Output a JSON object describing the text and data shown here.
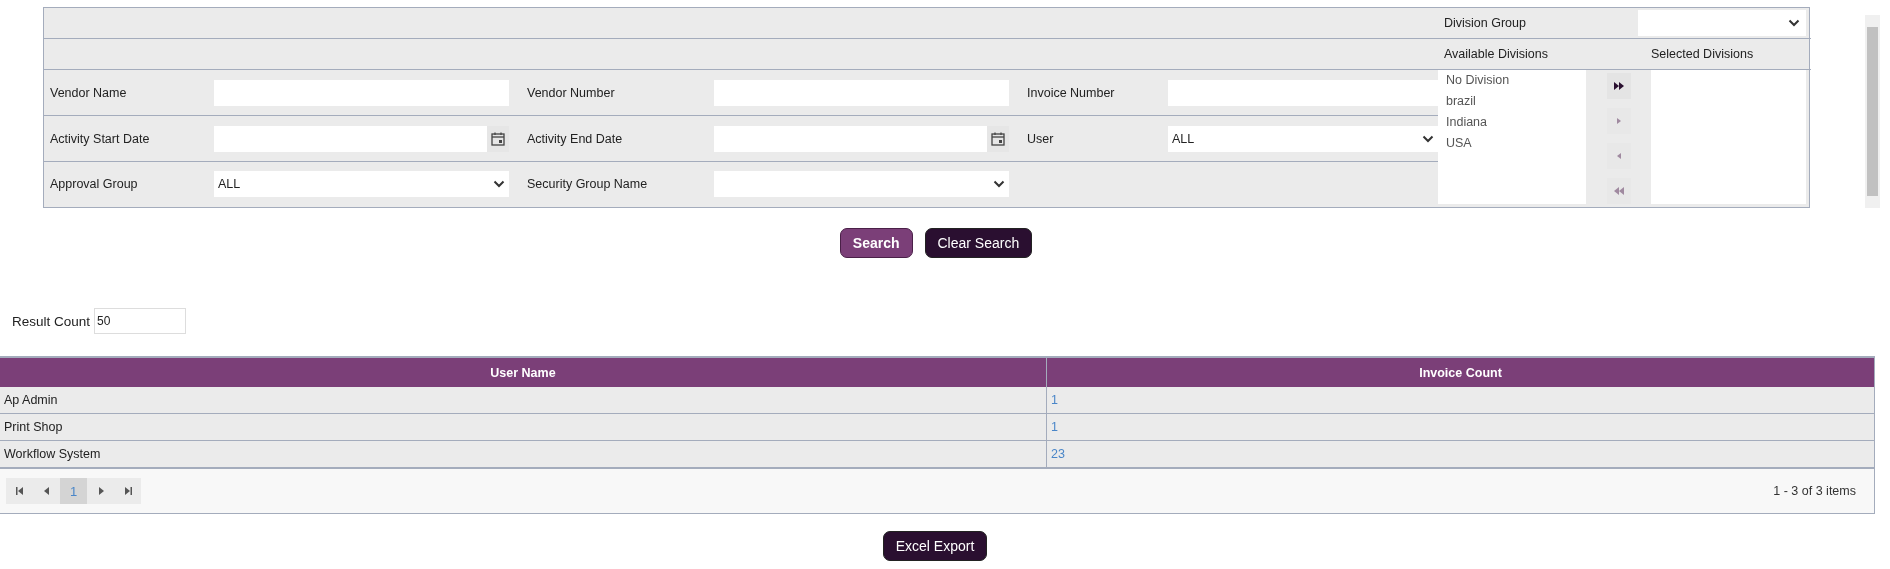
{
  "division_group": {
    "label": "Division Group"
  },
  "filter_rows": [
    {
      "fields": [
        {
          "label": "Vendor Name",
          "kind": "text"
        },
        {
          "label": "Vendor Number",
          "kind": "text"
        },
        {
          "label": "Invoice Number",
          "kind": "text"
        }
      ]
    },
    {
      "fields": [
        {
          "label": "Activity Start Date",
          "kind": "date"
        },
        {
          "label": "Activity End Date",
          "kind": "date"
        },
        {
          "label": "User",
          "kind": "select",
          "value": "ALL"
        }
      ]
    },
    {
      "fields": [
        {
          "label": "Approval Group",
          "kind": "select",
          "value": "ALL"
        },
        {
          "label": "Security Group Name",
          "kind": "select"
        }
      ]
    }
  ],
  "divisions": {
    "available_label": "Available Divisions",
    "selected_label": "Selected Divisions",
    "available": [
      "No Division",
      "brazil",
      "Indiana",
      "USA"
    ],
    "transfer_buttons": [
      {
        "kind": "move-all-right",
        "disabled": false
      },
      {
        "kind": "move-right",
        "disabled": true
      },
      {
        "kind": "move-left",
        "disabled": true
      },
      {
        "kind": "move-all-left",
        "disabled": true
      }
    ]
  },
  "buttons": [
    {
      "label": "Search",
      "kind": "primary"
    },
    {
      "label": "Clear Search",
      "kind": "secondary"
    }
  ],
  "result_count": {
    "label": "Result Count",
    "value": "50"
  },
  "table": {
    "columns": [
      "User Name",
      "Invoice Count"
    ],
    "rows": [
      [
        "Ap Admin",
        "1"
      ],
      [
        "Print Shop",
        "1"
      ],
      [
        "Workflow System",
        "23"
      ]
    ]
  },
  "pager": {
    "pages": [
      {
        "label": "1",
        "selected": true
      }
    ],
    "summary": "1 - 3 of 3 items"
  },
  "export_button": {
    "label": "Excel Export"
  }
}
